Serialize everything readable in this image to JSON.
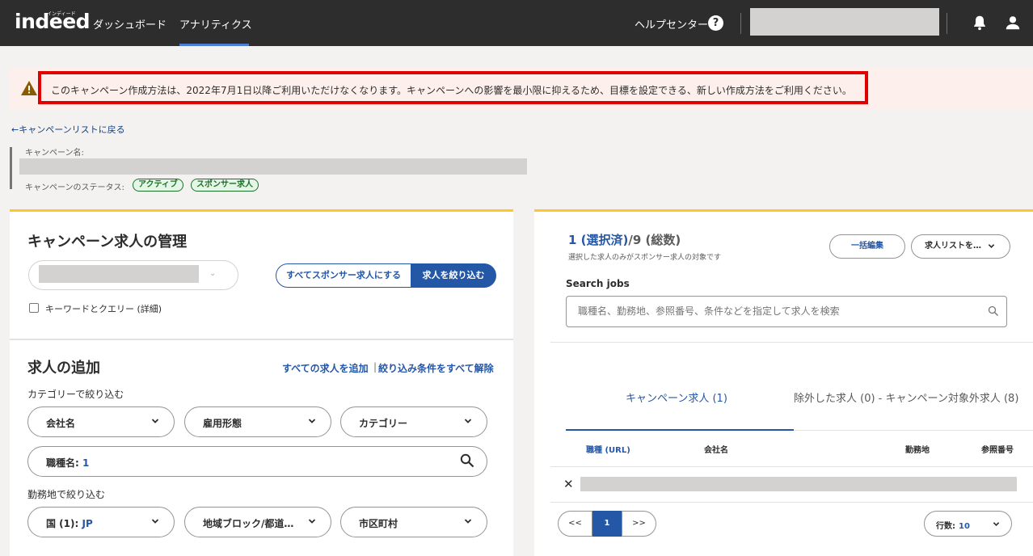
{
  "header": {
    "logo": "indeed",
    "logo_sup": "インディード",
    "nav": [
      {
        "label": "ダッシュボード"
      },
      {
        "label": "アナリティクス"
      }
    ],
    "help_label": "ヘルプセンター",
    "help_icon": "?"
  },
  "alert": {
    "text": "このキャンペーン作成方法は、2022年7月1日以降ご利用いただけなくなります。キャンペーンへの影響を最小限に抑えるため、目標を設定できる、新しい作成方法をご利用ください。"
  },
  "campaign": {
    "back_link": "←キャンペーンリストに戻る",
    "name_label": "キャンペーン名:",
    "status_label": "キャンペーンのステータス:",
    "status_badges": [
      "アクティブ",
      "スポンサー求人"
    ]
  },
  "manage": {
    "title": "キャンペーン求人の管理",
    "seg_all": "すべてスポンサー求人にする",
    "seg_filter": "求人を絞り込む",
    "keyword_checkbox": "キーワードとクエリー (詳細)"
  },
  "add": {
    "title": "求人の追加",
    "add_all": "すべての求人を追加",
    "separator": "|",
    "clear_all": "絞り込み条件をすべて解除",
    "category_label": "カテゴリーで絞り込む",
    "filters": [
      {
        "label": "会社名"
      },
      {
        "label": "雇用形態"
      },
      {
        "label": "カテゴリー"
      }
    ],
    "title_filter_label": "職種名:",
    "title_filter_value": "1",
    "location_label": "勤務地で絞り込む",
    "location_filters": [
      {
        "label": "国 (1):",
        "value": "JP"
      },
      {
        "label": "地域ブロック/都道…",
        "value": ""
      },
      {
        "label": "市区町村",
        "value": ""
      }
    ]
  },
  "jobs": {
    "count_selected": "1 (選択済)",
    "count_total": "/9 (総数)",
    "count_note": "選択した求人のみがスポンサー求人の対象です",
    "bulk_edit": "一括編集",
    "job_list": "求人リストを…",
    "search_label": "Search jobs",
    "search_placeholder": "職種名、勤務地、参照番号、条件などを指定して求人を検索",
    "tabs": [
      {
        "label": "キャンペーン求人 (1)"
      },
      {
        "label": "除外した求人 (0) - キャンペーン対象外求人 (8)"
      }
    ],
    "columns": [
      "職種 (URL)",
      "会社名",
      "勤務地",
      "参照番号"
    ],
    "remove_mark": "✕",
    "pager": {
      "prev": "<<",
      "current": "1",
      "next": ">>"
    },
    "rows_label": "行数:",
    "rows_value": "10"
  },
  "colors": {
    "topbar": "#2d2d2d",
    "accent": "#2557a7",
    "panel_top": "#ffc629",
    "alert_frame": "#e00000",
    "alert_bg": "#fdf0ec",
    "badge_green": "#1e6f2a"
  },
  "icons": [
    "help-icon",
    "bell-icon",
    "user-icon",
    "warning-icon",
    "chevron-down-icon",
    "search-icon"
  ]
}
